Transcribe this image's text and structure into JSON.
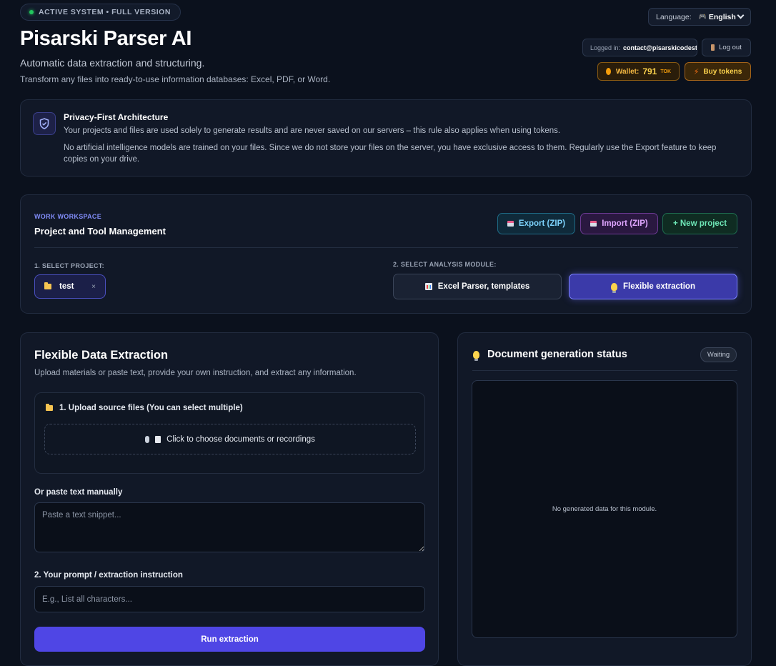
{
  "header": {
    "status_badge": "ACTIVE SYSTEM • FULL VERSION",
    "title": "Pisarski Parser AI",
    "subtitle": "Automatic data extraction and structuring.",
    "description": "Transform any files into ready-to-use information databases: Excel, PDF, or Word.",
    "language_label": "Language:",
    "language_value": "English",
    "logged_in_label": "Logged in:",
    "logged_in_email": "contact@pisarskicodest",
    "logout_label": "Log out",
    "wallet_label": "Wallet:",
    "wallet_amount": "791",
    "wallet_unit": "TOK",
    "buy_tokens_label": "Buy tokens"
  },
  "privacy": {
    "title": "Privacy-First Architecture",
    "line1": "Your projects and files are used solely to generate results and are never saved on our servers – this rule also applies when using tokens.",
    "line2": "No artificial intelligence models are trained on your files. Since we do not store your files on the server, you have exclusive access to them. Regularly use the Export feature to keep copies on your drive."
  },
  "workspace": {
    "eyebrow": "WORK WORKSPACE",
    "title": "Project and Tool Management",
    "export_label": "Export (ZIP)",
    "import_label": "Import (ZIP)",
    "new_project_label": "+ New project",
    "select_project_label": "1. SELECT PROJECT:",
    "project_name": "test",
    "project_close": "×",
    "select_module_label": "2. SELECT ANALYSIS MODULE:",
    "module_excel_label": "Excel Parser, templates",
    "module_flex_label": "Flexible extraction"
  },
  "extraction": {
    "title": "Flexible Data Extraction",
    "subtitle": "Upload materials or paste text, provide your own instruction, and extract any information.",
    "upload_heading": "1. Upload source files (You can select multiple)",
    "dropzone_label": "Click to choose documents or recordings",
    "paste_label": "Or paste text manually",
    "paste_placeholder": "Paste a text snippet...",
    "prompt_label": "2. Your prompt / extraction instruction",
    "prompt_placeholder": "E.g., List all characters...",
    "run_label": "Run extraction"
  },
  "status": {
    "title": "Document generation status",
    "badge": "Waiting",
    "empty_message": "No generated data for this module."
  },
  "icons": {
    "status_dot": "status-dot-icon",
    "language": "gamepad-icon",
    "chevron": "chevron-down-icon",
    "logout": "door-icon",
    "wallet": "coin-icon",
    "buy": "lightning-icon",
    "privacy": "shield-check-icon",
    "export": "package-icon",
    "import": "package-icon",
    "project": "folder-icon",
    "excel": "bar-chart-icon",
    "flex": "lightbulb-icon",
    "upload": "folder-icon",
    "dropzone": "microphone-document-icon",
    "status_title": "lightbulb-icon"
  },
  "colors": {
    "background": "#0b111d",
    "accent": "#4f46e5",
    "success": "#22c55e",
    "wallet": "#f59e0b"
  }
}
